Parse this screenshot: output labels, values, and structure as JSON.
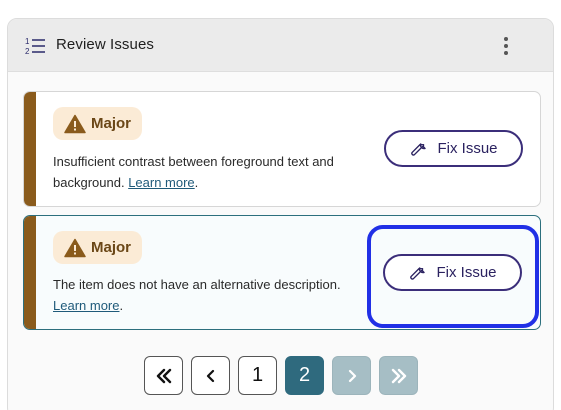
{
  "panel": {
    "title": "Review Issues",
    "menu_icon": "kebab-menu-icon",
    "list_icon": "numbered-list-icon"
  },
  "issues": [
    {
      "severity": "Major",
      "severity_icon": "warning-triangle-icon",
      "description": "Insufficient contrast between foreground text and background.",
      "link_text": "Learn more",
      "action_label": "Fix Issue",
      "action_icon": "wrench-icon"
    },
    {
      "severity": "Major",
      "severity_icon": "warning-triangle-icon",
      "description": "The item does not have an alternative description.",
      "link_text": "Learn more",
      "action_label": "Fix Issue",
      "action_icon": "wrench-icon"
    }
  ],
  "pagination": {
    "first_icon": "double-chevron-left-icon",
    "prev_icon": "chevron-left-icon",
    "pages": [
      "1",
      "2"
    ],
    "current_page": "2",
    "next_icon": "chevron-right-icon",
    "last_icon": "double-chevron-right-icon"
  },
  "colors": {
    "severity_bar": "#8a5b1c",
    "badge_bg": "#fbebd6",
    "active_page": "#2f6a7e",
    "focus_ring": "#2130e6"
  }
}
